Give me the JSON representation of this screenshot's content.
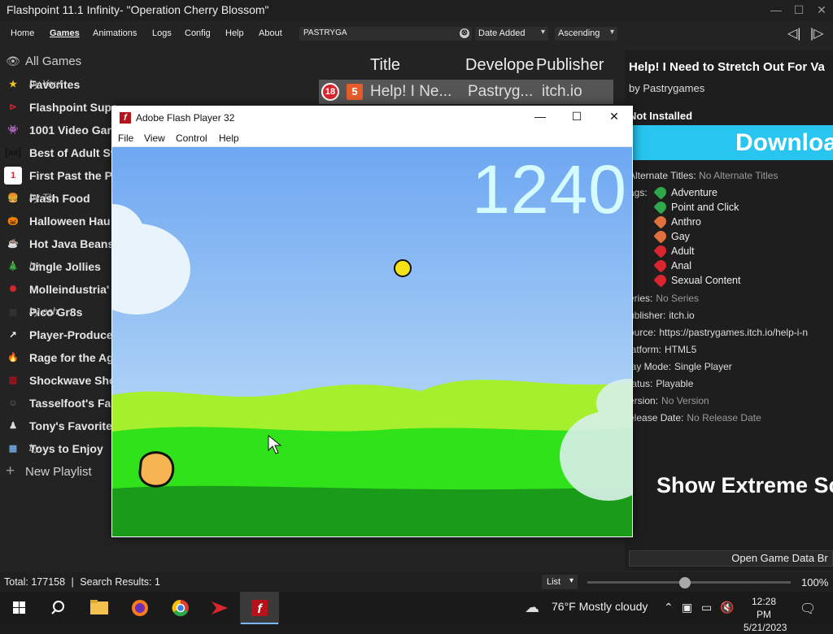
{
  "window": {
    "title": "Flashpoint 11.1 Infinity- \"Operation Cherry Blossom\"",
    "minimize": "—",
    "maximize": "☐",
    "close": "✕"
  },
  "menu": {
    "items": [
      "Home",
      "Games",
      "Animations",
      "Logs",
      "Config",
      "Help",
      "About"
    ],
    "active": "Games"
  },
  "search": {
    "value": "PASTRYGA",
    "clear": "⊗"
  },
  "sort": {
    "field": "Date Added",
    "order": "Ascending",
    "arrow": "▾"
  },
  "nav": {
    "prev": "◁|",
    "next": "|▷"
  },
  "sidebar": {
    "all_games": "All Games",
    "new_playlist": "New Playlist",
    "playlists": [
      {
        "label": "Favorites",
        "author": "by You!",
        "icon": "star-icon",
        "color": "#f5c518",
        "glyph": "★"
      },
      {
        "label": "Flashpoint Supe",
        "author": "",
        "icon": "flashpoint-icon",
        "color": "#d9262e",
        "glyph": "⊳"
      },
      {
        "label": "1001 Video Gar",
        "author": "",
        "icon": "space-invader-icon",
        "color": "#2e2e2e",
        "glyph": "👾"
      },
      {
        "label": "Best of Adult Sv",
        "author": "",
        "icon": "as-icon",
        "color": "#111",
        "glyph": "[as]"
      },
      {
        "label": "First Past the Po",
        "author": "",
        "icon": "number-one-icon",
        "color": "#d9262e",
        "glyph": "1"
      },
      {
        "label": "Flash Food",
        "author": "by Th",
        "icon": "burger-icon",
        "color": "#c8842b",
        "glyph": "🍔"
      },
      {
        "label": "Halloween Hau",
        "author": "",
        "icon": "pumpkin-icon",
        "color": "#e8731c",
        "glyph": "🎃"
      },
      {
        "label": "Hot Java Beans",
        "author": "",
        "icon": "java-icon",
        "color": "#eee",
        "glyph": "☕"
      },
      {
        "label": "Jingle Jollies",
        "author": "by",
        "icon": "tree-icon",
        "color": "#2e8b3a",
        "glyph": "🎄"
      },
      {
        "label": "Molleindustria'",
        "author": "",
        "icon": "molleindustria-icon",
        "color": "#d9262e",
        "glyph": "✺"
      },
      {
        "label": "Pico Gr8s",
        "author": "by osh",
        "icon": "pico-icon",
        "color": "#333",
        "glyph": "▦"
      },
      {
        "label": "Player-Produce",
        "author": "",
        "icon": "share-icon",
        "color": "#fff",
        "glyph": "↗"
      },
      {
        "label": "Rage for the Ag",
        "author": "",
        "icon": "flame-icon",
        "color": "#e8481c",
        "glyph": "🔥"
      },
      {
        "label": "Shockwave Sho",
        "author": "",
        "icon": "shockwave-icon",
        "color": "#b5121b",
        "glyph": "▥"
      },
      {
        "label": "Tasselfoot's Fav",
        "author": "",
        "icon": "tasselfoot-avatar-icon",
        "color": "#8a6a4a",
        "glyph": "☺"
      },
      {
        "label": "Tony's Favorites",
        "author": "",
        "icon": "tony-avatar-icon",
        "color": "#ddd",
        "glyph": "♟"
      },
      {
        "label": "Toys to Enjoy",
        "author": "by",
        "icon": "toy-blocks-icon",
        "color": "#6aa0d8",
        "glyph": "▩"
      }
    ]
  },
  "game_list": {
    "columns": [
      "Title",
      "Develope",
      "Publisher"
    ],
    "rows": [
      {
        "age": "18",
        "platform": "5",
        "title": "Help! I Ne...",
        "developer": "Pastryg...",
        "publisher": "itch.io"
      }
    ]
  },
  "details": {
    "title": "Help! I Need to Stretch Out For Va",
    "by": "by Pastrygames",
    "status": "Not Installed",
    "download": "Downloa",
    "alt_titles_label": "Alternate Titles:",
    "alt_titles_value": "No Alternate Titles",
    "tags_label": "ags:",
    "tags": [
      {
        "name": "Adventure",
        "color": "#2ea84a"
      },
      {
        "name": "Point and Click",
        "color": "#2ea84a"
      },
      {
        "name": "Anthro",
        "color": "#e0713c"
      },
      {
        "name": "Gay",
        "color": "#e0713c"
      },
      {
        "name": "Adult",
        "color": "#d9262e"
      },
      {
        "name": "Anal",
        "color": "#d9262e"
      },
      {
        "name": "Sexual Content",
        "color": "#d9262e"
      }
    ],
    "fields": [
      {
        "label": "eries:",
        "value": "No Series",
        "muted": true
      },
      {
        "label": "ublisher:",
        "value": "itch.io",
        "muted": false
      },
      {
        "label": "ource:",
        "value": "https://pastrygames.itch.io/help-i-n",
        "muted": false
      },
      {
        "label": "latform:",
        "value": "HTML5",
        "muted": false
      },
      {
        "label": "lay Mode:",
        "value": "Single Player",
        "muted": false
      },
      {
        "label": "tatus:",
        "value": "Playable",
        "muted": false
      },
      {
        "label": "ersion:",
        "value": "No Version",
        "muted": true
      },
      {
        "label": "elease Date:",
        "value": "No Release Date",
        "muted": true
      }
    ],
    "extreme": "Show Extreme Sc",
    "open_data": "Open Game Data Br"
  },
  "statusbar": {
    "total": "Total: 177158",
    "separator": "|",
    "results": "Search Results: 1",
    "view": "List",
    "zoom": "100%",
    "zoom_level": 0.48
  },
  "flash": {
    "logo": "f",
    "title": "Adobe Flash Player 32",
    "menu": [
      "File",
      "View",
      "Control",
      "Help"
    ],
    "score": "1240"
  },
  "taskbar": {
    "weather": "76°F  Mostly cloudy",
    "time": "12:28 PM",
    "date": "5/21/2023"
  },
  "colors": {
    "accent": "#27c5f0",
    "age_badge": "#d9262e",
    "sky_top": "#6ea7f2",
    "grass": "#22e000"
  }
}
